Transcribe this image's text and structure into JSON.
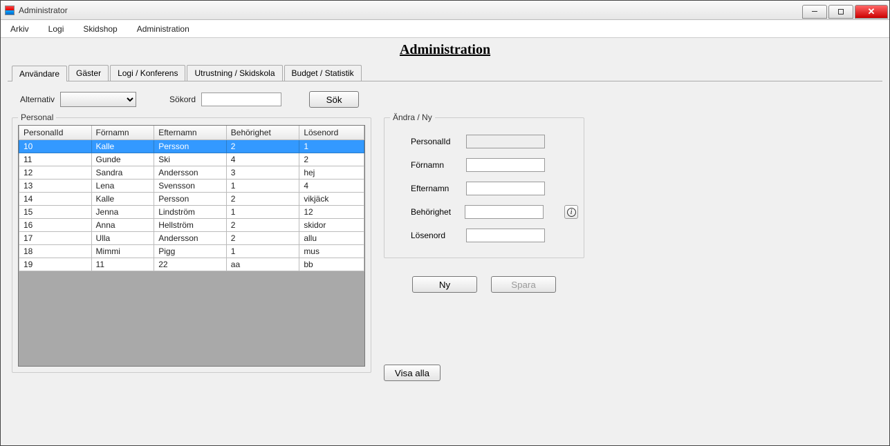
{
  "window": {
    "title": "Administrator"
  },
  "menu": {
    "arkiv": "Arkiv",
    "logi": "Logi",
    "skidshop": "Skidshop",
    "administration": "Administration"
  },
  "page": {
    "title": "Administration"
  },
  "tabs": {
    "anvandare": "Användare",
    "gaster": "Gäster",
    "logikonferens": "Logi / Konferens",
    "utrustning": "Utrustning / Skidskola",
    "budget": "Budget / Statistik"
  },
  "filter": {
    "alternativ_label": "Alternativ",
    "alternativ_value": "",
    "sokord_label": "Sökord",
    "sokord_value": "",
    "sok_btn": "Sök"
  },
  "personal_group": "Personal",
  "grid": {
    "headers": {
      "id": "PersonalId",
      "fornamn": "Förnamn",
      "efternamn": "Efternamn",
      "behorighet": "Behörighet",
      "losenord": "Lösenord"
    },
    "rows": [
      {
        "id": "10",
        "fornamn": "Kalle",
        "efternamn": "Persson",
        "behorighet": "2",
        "losenord": "1",
        "selected": true
      },
      {
        "id": "11",
        "fornamn": "Gunde",
        "efternamn": "Ski",
        "behorighet": "4",
        "losenord": "2"
      },
      {
        "id": "12",
        "fornamn": "Sandra",
        "efternamn": "Andersson",
        "behorighet": "3",
        "losenord": "hej"
      },
      {
        "id": "13",
        "fornamn": "Lena",
        "efternamn": "Svensson",
        "behorighet": "1",
        "losenord": "4"
      },
      {
        "id": "14",
        "fornamn": "Kalle",
        "efternamn": "Persson",
        "behorighet": "2",
        "losenord": "vikjäck"
      },
      {
        "id": "15",
        "fornamn": "Jenna",
        "efternamn": "Lindström",
        "behorighet": "1",
        "losenord": "12"
      },
      {
        "id": "16",
        "fornamn": "Anna",
        "efternamn": "Hellström",
        "behorighet": "2",
        "losenord": "skidor"
      },
      {
        "id": "17",
        "fornamn": "Ulla",
        "efternamn": "Andersson",
        "behorighet": "2",
        "losenord": "allu"
      },
      {
        "id": "18",
        "fornamn": "Mimmi",
        "efternamn": "Pigg",
        "behorighet": "1",
        "losenord": "mus"
      },
      {
        "id": "19",
        "fornamn": "11",
        "efternamn": "22",
        "behorighet": "aa",
        "losenord": "bb"
      }
    ]
  },
  "edit": {
    "group": "Ändra / Ny",
    "personalid_label": "PersonalId",
    "personalid_value": "",
    "fornamn_label": "Förnamn",
    "fornamn_value": "",
    "efternamn_label": "Efternamn",
    "efternamn_value": "",
    "behorighet_label": "Behörighet",
    "behorighet_value": "",
    "losenord_label": "Lösenord",
    "losenord_value": "",
    "ny_btn": "Ny",
    "spara_btn": "Spara"
  },
  "visa_alla": "Visa alla"
}
